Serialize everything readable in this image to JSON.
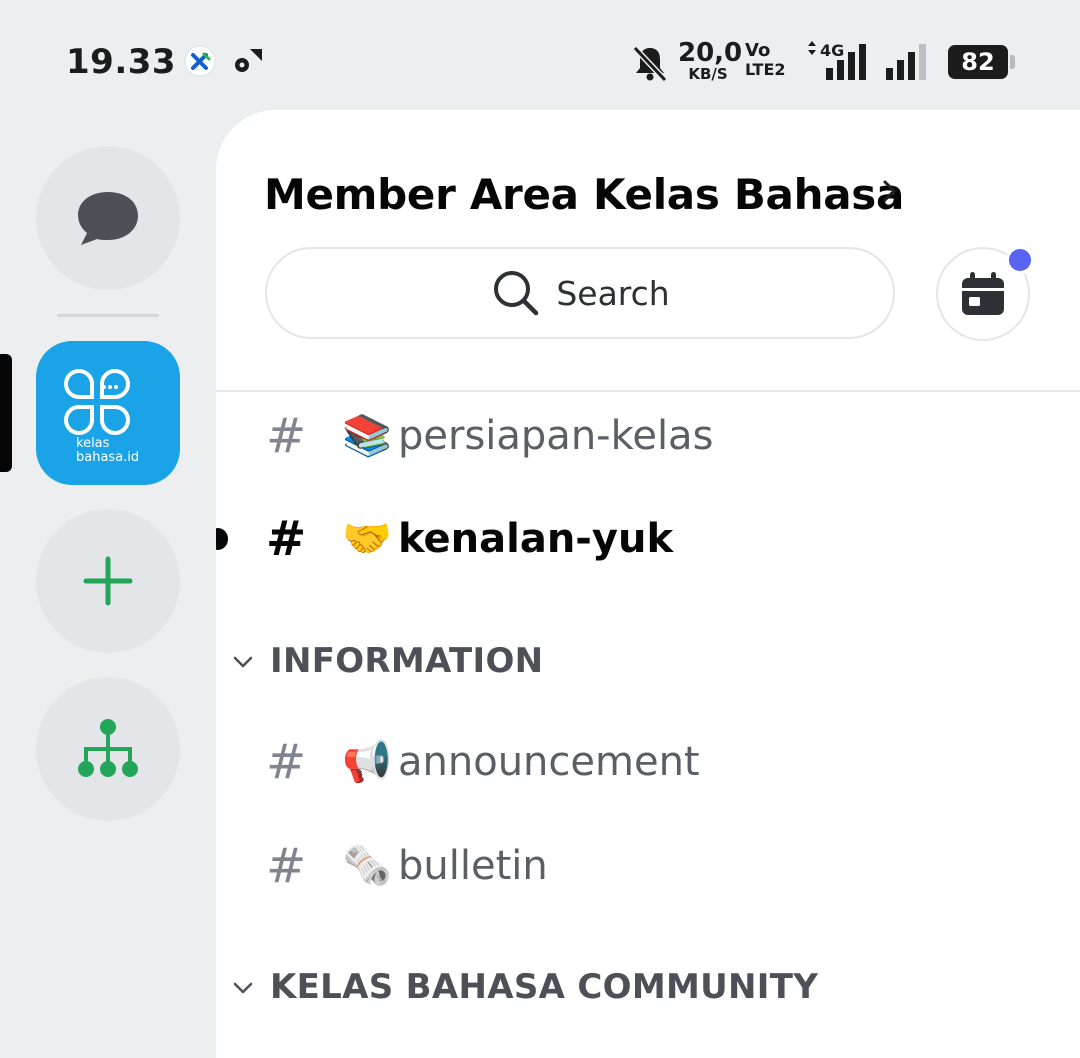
{
  "status_bar": {
    "time": "19.33",
    "net_speed_value": "20,0",
    "net_speed_unit": "KB/S",
    "volte_top": "Vo",
    "volte_bottom": "LTE2",
    "network_type": "4G",
    "battery": "82"
  },
  "rail": {
    "server_logo_line1": "kelas",
    "server_logo_line2": "bahasa.id",
    "accent_color": "#23a55a",
    "server_color": "#1aa3e6"
  },
  "server": {
    "title": "Member Area Kelas Bahasa",
    "search_placeholder": "Search"
  },
  "channels_top": [
    {
      "hash": "#",
      "emoji": "📚",
      "name": "persiapan-kelas",
      "unread": false
    },
    {
      "hash": "#",
      "emoji": "🤝",
      "name": "kenalan-yuk",
      "unread": true
    }
  ],
  "categories": [
    {
      "label": "INFORMATION",
      "channels": [
        {
          "hash": "#",
          "emoji": "📢",
          "name": "announcement"
        },
        {
          "hash": "#",
          "emoji": "🗞️",
          "name": "bulletin"
        }
      ]
    },
    {
      "label": "KELAS BAHASA COMMUNITY",
      "channels": []
    }
  ],
  "colors": {
    "notification_dot": "#5865f2",
    "unread_text": "#060607",
    "muted_text": "#5c5e66"
  }
}
